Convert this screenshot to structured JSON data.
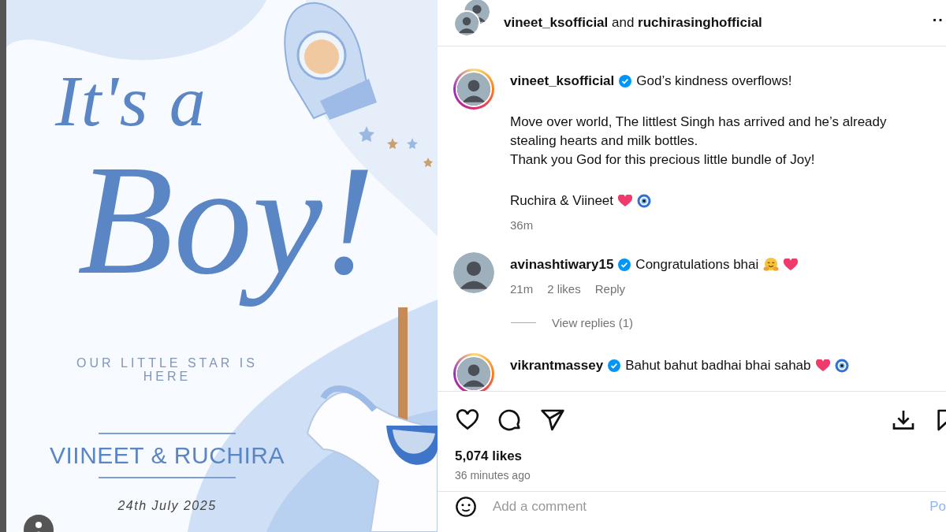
{
  "card": {
    "headline_small": "It's a",
    "headline_large": "Boy!",
    "tagline": "OUR LITTLE STAR IS HERE",
    "names": "VIINEET & RUCHIRA",
    "date": "24th July 2025"
  },
  "header": {
    "accounts": [
      "vineet_ksofficial",
      "ruchirasinghofficial"
    ],
    "joiner": "and",
    "more": "··"
  },
  "caption": {
    "username": "vineet_ksofficial",
    "verified": true,
    "story_ring": true,
    "first_line": "God’s kindness overflows!",
    "paragraphs": [
      "Move over world, The littlest Singh has arrived and he’s already stealing hearts and milk bottles.",
      "Thank you God for this precious little bundle of Joy!"
    ],
    "signature": "Ruchira & Viineet",
    "signature_emojis": [
      {
        "kind": "heart"
      },
      {
        "kind": "evil-eye"
      }
    ],
    "time": "36m"
  },
  "comments": [
    {
      "username": "avinashtiwary15",
      "verified": true,
      "story_ring": false,
      "text": "Congratulations bhai",
      "emojis": [
        {
          "kind": "hug"
        },
        {
          "kind": "heart"
        }
      ],
      "time": "21m",
      "likes": "2 likes",
      "reply": "Reply",
      "view_replies": "View replies (1)"
    },
    {
      "username": "vikrantmassey",
      "verified": true,
      "story_ring": true,
      "text": "Bahut bahut badhai bhai sahab",
      "emojis": [
        {
          "kind": "heart"
        },
        {
          "kind": "evil-eye"
        }
      ]
    }
  ],
  "likes": "5,074 likes",
  "posted": "36 minutes ago",
  "comment_field": {
    "placeholder": "Add a comment",
    "post": "Po"
  }
}
